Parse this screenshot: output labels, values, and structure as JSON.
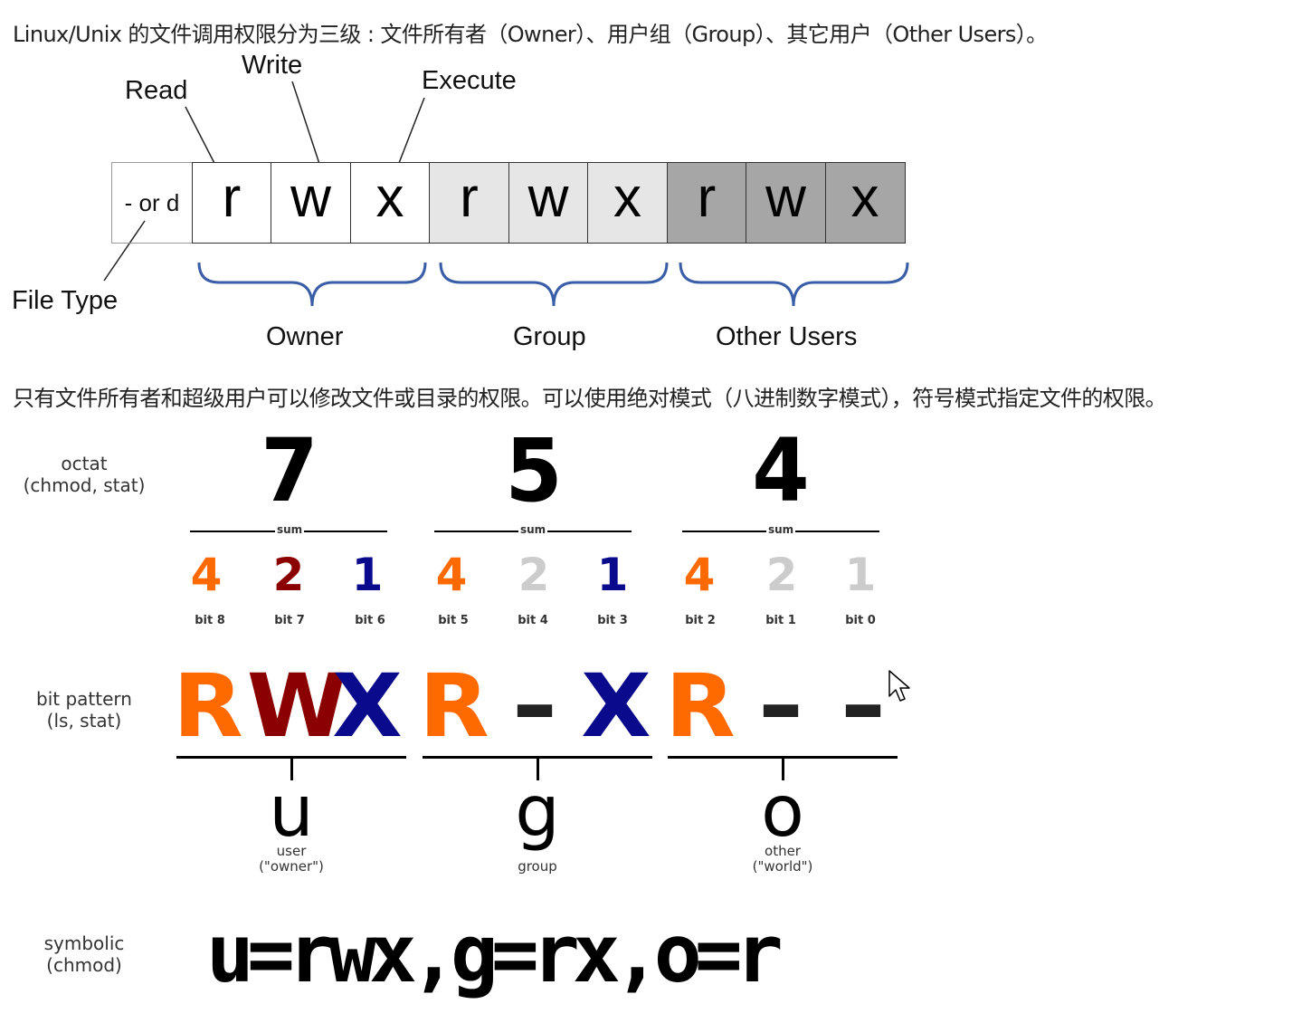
{
  "paragraphs": {
    "intro": "Linux/Unix 的文件调用权限分为三级 : 文件所有者（Owner）、用户组（Group）、其它用户（Other Users）。",
    "second": "只有文件所有者和超级用户可以修改文件或目录的权限。可以使用绝对模式（八进制数字模式），符号模式指定文件的权限。"
  },
  "figure1": {
    "labels": {
      "read": "Read",
      "write": "Write",
      "execute": "Execute",
      "file_type": "File Type"
    },
    "file_type_cell": "- or d",
    "cells": [
      {
        "text": "r",
        "group": "owner"
      },
      {
        "text": "w",
        "group": "owner"
      },
      {
        "text": "x",
        "group": "owner"
      },
      {
        "text": "r",
        "group": "group"
      },
      {
        "text": "w",
        "group": "group"
      },
      {
        "text": "x",
        "group": "group"
      },
      {
        "text": "r",
        "group": "other"
      },
      {
        "text": "w",
        "group": "other"
      },
      {
        "text": "x",
        "group": "other"
      }
    ],
    "group_labels": {
      "owner": "Owner",
      "group": "Group",
      "other": "Other Users"
    },
    "colors": {
      "owner_bg": "#ffffff",
      "group_bg": "#e6e6e6",
      "other_bg": "#a6a6a6",
      "brace": "#3a5da8"
    }
  },
  "figure2": {
    "side_labels": {
      "octal_1": "octat",
      "octal_2": "(chmod, stat)",
      "bits_1": "bit pattern",
      "bits_2": "(ls, stat)",
      "symbolic_1": "symbolic",
      "symbolic_2": "(chmod)"
    },
    "octal_digits": [
      "7",
      "5",
      "4"
    ],
    "sum_label": "sum",
    "weights": [
      {
        "value": "4",
        "bit": "bit 8",
        "color": "#ff6a00"
      },
      {
        "value": "2",
        "bit": "bit 7",
        "color": "#8b0000"
      },
      {
        "value": "1",
        "bit": "bit 6",
        "color": "#0a0a8c"
      },
      {
        "value": "4",
        "bit": "bit 5",
        "color": "#ff6a00"
      },
      {
        "value": "2",
        "bit": "bit 4",
        "color": "#cccccc"
      },
      {
        "value": "1",
        "bit": "bit 3",
        "color": "#0a0a8c"
      },
      {
        "value": "4",
        "bit": "bit 2",
        "color": "#ff6a00"
      },
      {
        "value": "2",
        "bit": "bit 1",
        "color": "#cccccc"
      },
      {
        "value": "1",
        "bit": "bit 0",
        "color": "#cccccc"
      }
    ],
    "pattern": [
      {
        "char": "R",
        "color": "#ff6a00"
      },
      {
        "char": "W",
        "color": "#8b0000"
      },
      {
        "char": "X",
        "color": "#0a0a8c"
      },
      {
        "char": "R",
        "color": "#ff6a00"
      },
      {
        "char": "-",
        "color": "#222222"
      },
      {
        "char": "X",
        "color": "#0a0a8c"
      },
      {
        "char": "R",
        "color": "#ff6a00"
      },
      {
        "char": "-",
        "color": "#222222"
      },
      {
        "char": "-",
        "color": "#222222"
      }
    ],
    "classes": [
      {
        "letter": "u",
        "caption_1": "user",
        "caption_2": "(\"owner\")"
      },
      {
        "letter": "g",
        "caption_1": "group",
        "caption_2": ""
      },
      {
        "letter": "o",
        "caption_1": "other",
        "caption_2": "(\"world\")"
      }
    ],
    "symbolic": "u=rwx,g=rx,o=r"
  }
}
